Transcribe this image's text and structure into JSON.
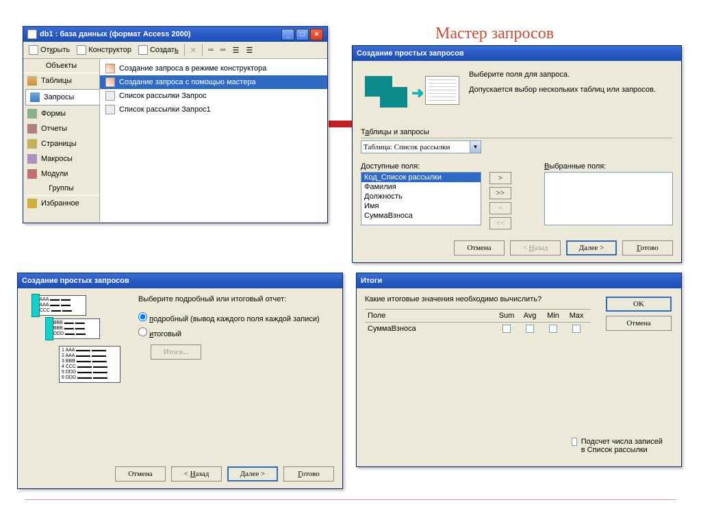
{
  "page": {
    "title": "Мастер запросов"
  },
  "dbwin": {
    "title": "db1 : база данных (формат Access 2000)",
    "toolbar": {
      "open": "Открыть",
      "design": "Конструктор",
      "create": "Создать"
    },
    "side": {
      "hdr_objects": "Объекты",
      "hdr_groups": "Группы",
      "tables": "Таблицы",
      "queries": "Запросы",
      "forms": "Формы",
      "reports": "Отчеты",
      "pages": "Страницы",
      "macros": "Макросы",
      "modules": "Модули",
      "favorites": "Избранное"
    },
    "list": {
      "i1": "Создание запроса в режиме конструктора",
      "i2": "Создание запроса с помощью мастера",
      "i3": "Список рассылки Запрос",
      "i4": "Список рассылки Запрос1"
    }
  },
  "wiz1": {
    "title": "Создание простых запросов",
    "p1": "Выберите поля для запроса.",
    "p2": "Допускается выбор нескольких таблиц или запросов.",
    "lbl_tables": "Таблицы и запросы",
    "select_val": "Таблица: Список рассылки",
    "lbl_avail": "Доступные поля:",
    "lbl_sel": "Выбранные поля:",
    "fields": {
      "f0": "Код_Список рассылки",
      "f1": "Фамилия",
      "f2": "Должность",
      "f3": "Имя",
      "f4": "СуммаВзноса"
    },
    "btn_add": ">",
    "btn_addall": ">>",
    "btn_rem": "<",
    "btn_remall": "<<",
    "btn_cancel": "Отмена",
    "btn_back": "< Назад",
    "btn_next": "Далее >",
    "btn_finish": "Готово"
  },
  "wiz2": {
    "title": "Создание простых запросов",
    "q": "Выберите подробный или итоговый отчет:",
    "opt1": "подробный (вывод каждого поля каждой записи)",
    "opt2": "итоговый",
    "btn_sum": "Итоги...",
    "btn_cancel": "Отмена",
    "btn_back": "< Назад",
    "btn_next": "Далее >",
    "btn_finish": "Готово"
  },
  "wiz3": {
    "title": "Итоги",
    "q": "Какие итоговые значения необходимо вычислить?",
    "col_field": "Поле",
    "col_sum": "Sum",
    "col_avg": "Avg",
    "col_min": "Min",
    "col_max": "Max",
    "row1": "СуммаВзноса",
    "btn_ok": "OK",
    "btn_cancel": "Отмена",
    "count": "Подсчет числа записей в Список рассылки"
  }
}
